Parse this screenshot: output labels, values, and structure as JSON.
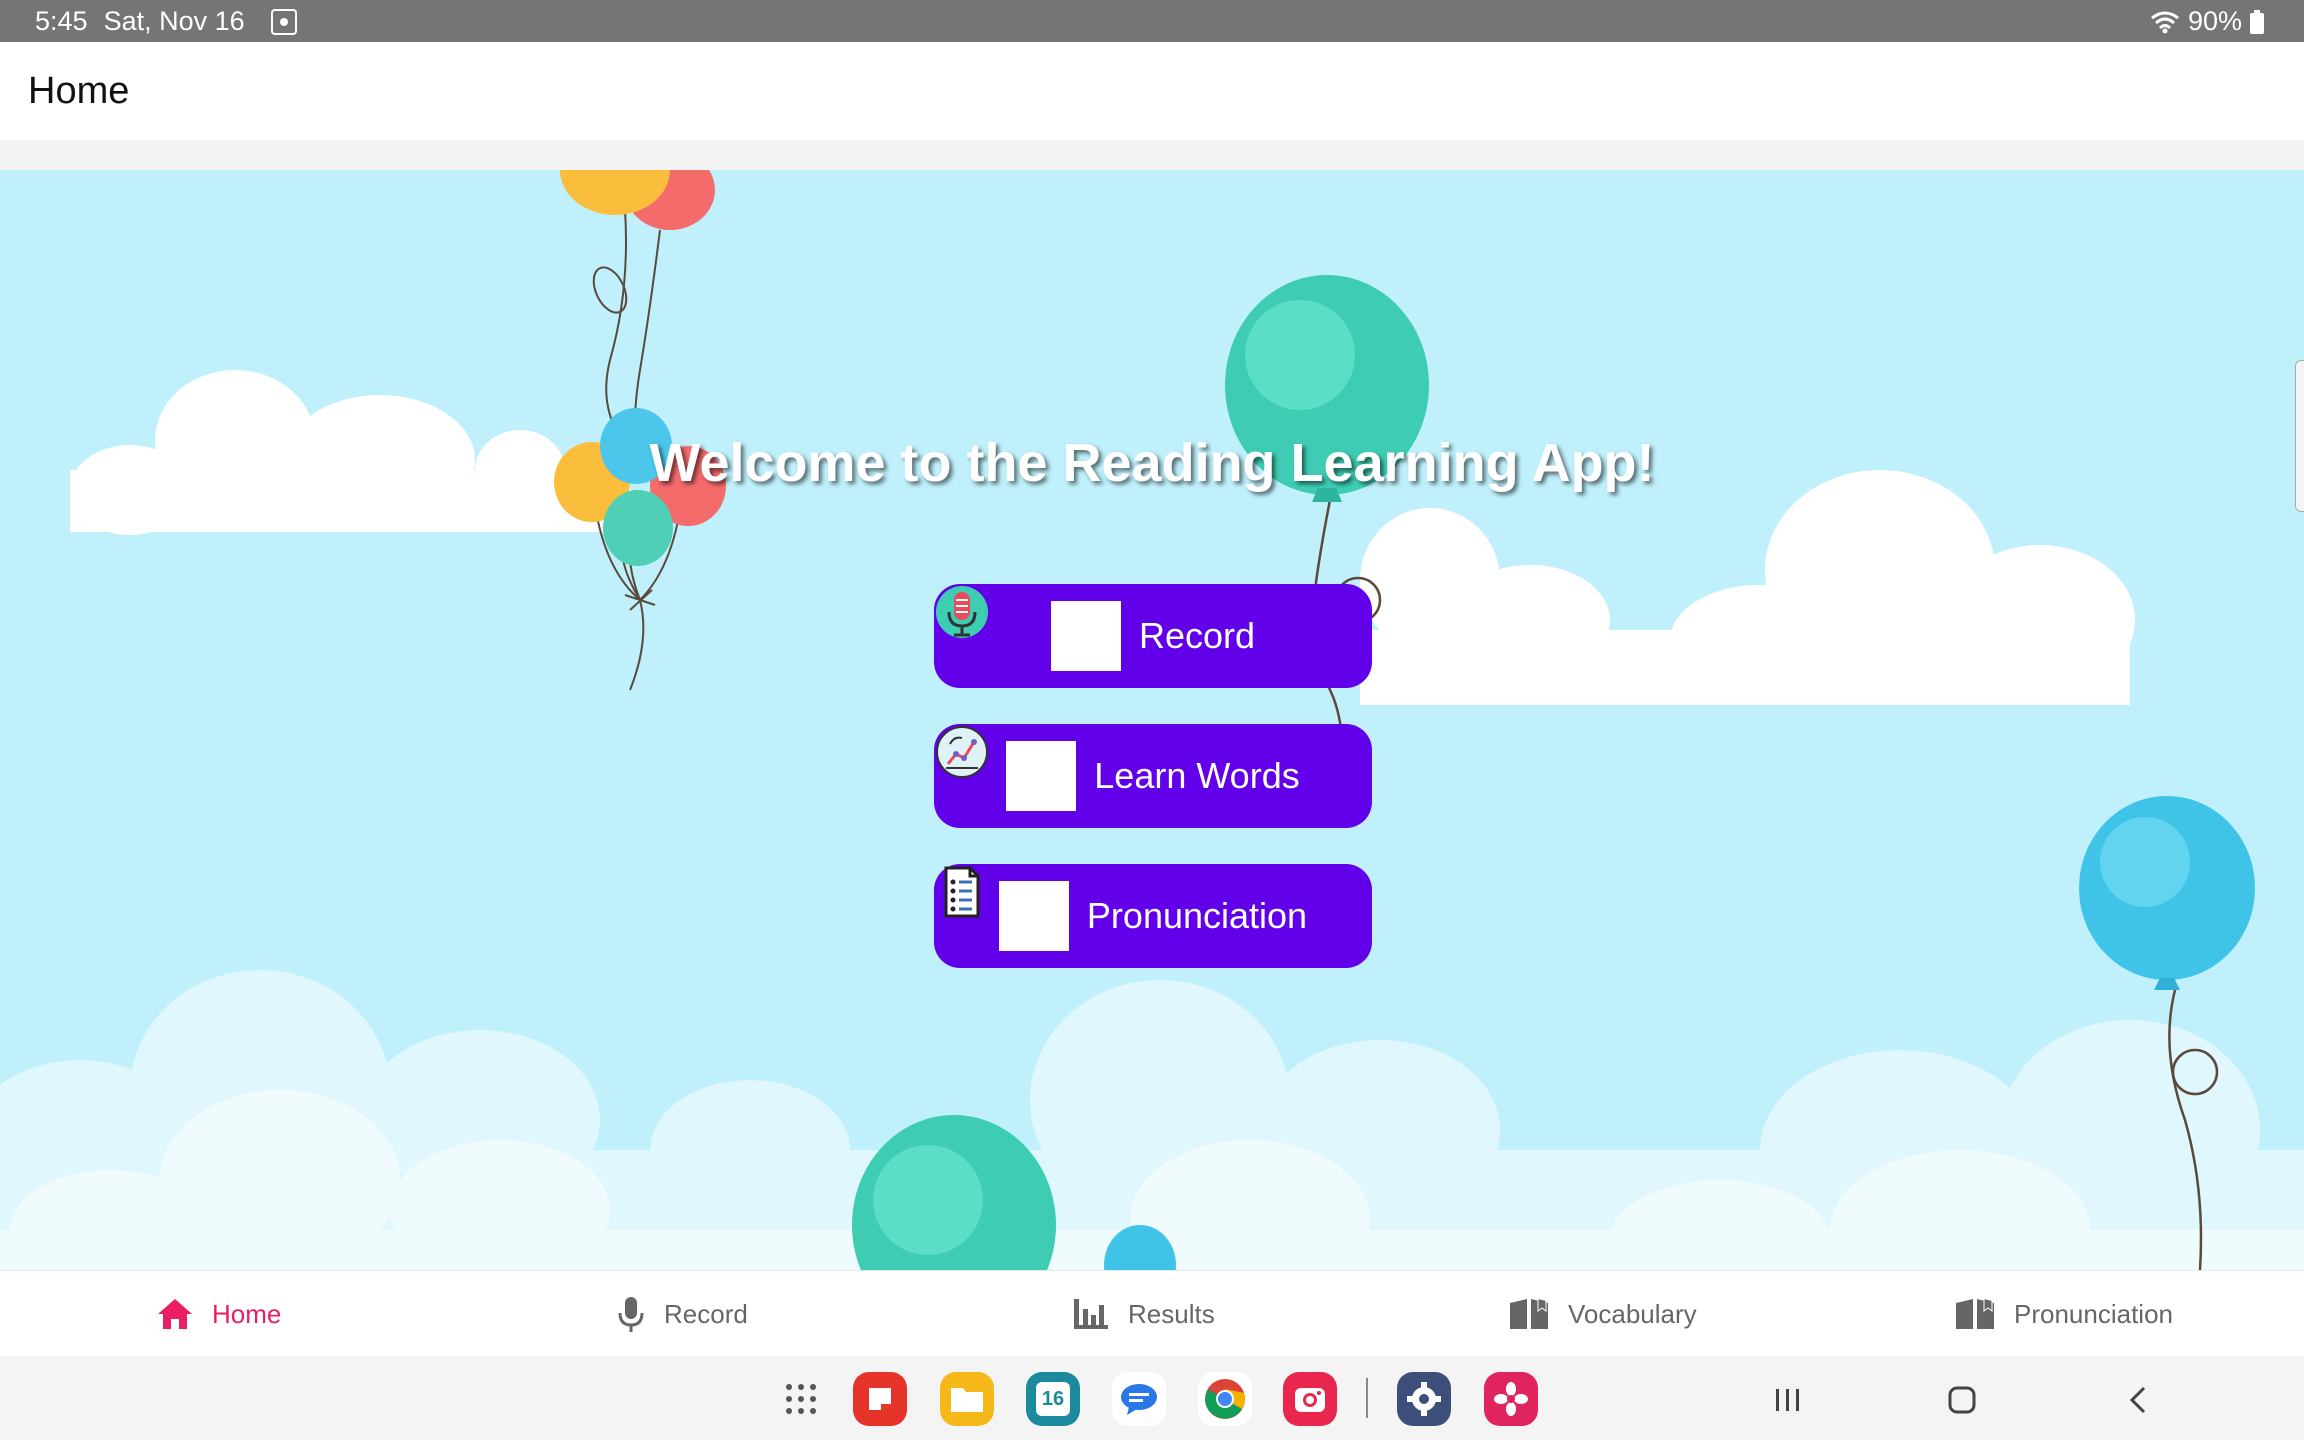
{
  "status_bar": {
    "time": "5:45",
    "date": "Sat, Nov 16",
    "battery": "90%"
  },
  "app_bar": {
    "title": "Home"
  },
  "main": {
    "welcome": "Welcome to the Reading Learning App!",
    "buttons": [
      {
        "label": "Record",
        "icon": "microphone-icon"
      },
      {
        "label": "Learn Words",
        "icon": "brain-chart-icon"
      },
      {
        "label": "Pronunciation",
        "icon": "document-list-icon"
      }
    ]
  },
  "bottom_nav": {
    "items": [
      {
        "label": "Home",
        "icon": "home-icon",
        "active": true
      },
      {
        "label": "Record",
        "icon": "mic-icon",
        "active": false
      },
      {
        "label": "Results",
        "icon": "bar-chart-icon",
        "active": false
      },
      {
        "label": "Vocabulary",
        "icon": "book-icon",
        "active": false
      },
      {
        "label": "Pronunciation",
        "icon": "book-icon",
        "active": false
      }
    ]
  },
  "taskbar": {
    "calendar_day": "16",
    "apps": [
      "app-drawer-icon",
      "notes-app-icon",
      "files-app-icon",
      "calendar-app-icon",
      "messages-app-icon",
      "chrome-app-icon",
      "camera-app-icon",
      "settings-app-icon",
      "flower-app-icon"
    ]
  },
  "colors": {
    "sky": "#bff0fc",
    "button": "#6200ea",
    "active_nav": "#e91e63",
    "status_bar": "#757575"
  }
}
